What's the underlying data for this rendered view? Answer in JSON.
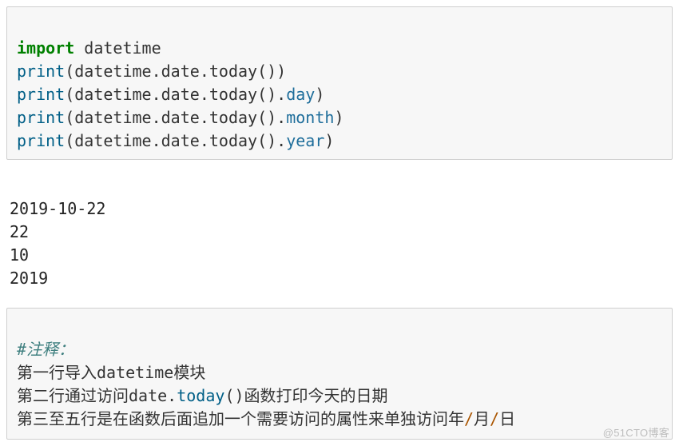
{
  "code": {
    "l1": {
      "kw": "import",
      "mod": " datetime"
    },
    "l2": {
      "fn": "print",
      "lp": "(",
      "a": "datetime",
      "d1": ".",
      "b": "date",
      "d2": ".",
      "c": "today",
      "call": "())"
    },
    "l3": {
      "fn": "print",
      "lp": "(",
      "a": "datetime",
      "d1": ".",
      "b": "date",
      "d2": ".",
      "c": "today",
      "call": "()",
      "d3": ".",
      "attr": "day",
      "rp": ")"
    },
    "l4": {
      "fn": "print",
      "lp": "(",
      "a": "datetime",
      "d1": ".",
      "b": "date",
      "d2": ".",
      "c": "today",
      "call": "()",
      "d3": ".",
      "attr": "month",
      "rp": ")"
    },
    "l5": {
      "fn": "print",
      "lp": "(",
      "a": "datetime",
      "d1": ".",
      "b": "date",
      "d2": ".",
      "c": "today",
      "call": "()",
      "d3": ".",
      "attr": "year",
      "rp": ")"
    }
  },
  "output": {
    "l1": "2019-10-22",
    "l2": "22",
    "l3": "10",
    "l4": "2019"
  },
  "comment": {
    "l1": {
      "t": "#注释："
    },
    "l2": {
      "p1": "第一行导入datetime模块"
    },
    "l3": {
      "p1": "第二行通过访问date",
      "d1": ".",
      "fn": "today",
      "call": "()",
      "p2": "函数打印今天的日期"
    },
    "l4": {
      "p1": "第三至五行是在函数后面追加一个需要访问的属性来单独访问年",
      "s1": "/",
      "p2": "月",
      "s2": "/",
      "p3": "日"
    }
  },
  "watermark": "@51CTO博客"
}
